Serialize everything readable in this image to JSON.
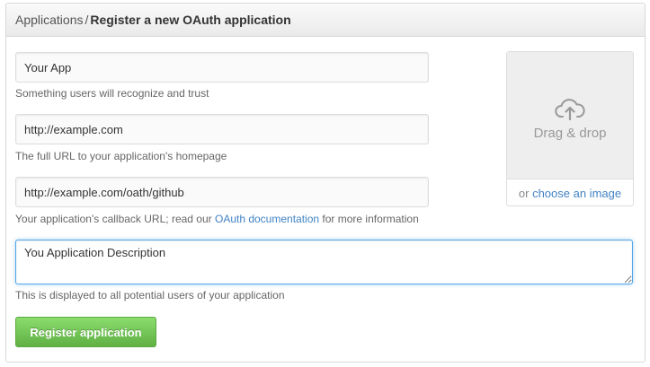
{
  "breadcrumb": {
    "parent": "Applications",
    "separator": "/",
    "current": "Register a new OAuth application"
  },
  "form": {
    "app_name": {
      "value": "Your App",
      "note": "Something users will recognize and trust"
    },
    "homepage_url": {
      "value": "http://example.com",
      "note": "The full URL to your application's homepage"
    },
    "callback_url": {
      "value": "http://example.com/oath/github",
      "note_prefix": "Your application's callback URL; read our ",
      "note_link": "OAuth documentation",
      "note_suffix": " for more information"
    },
    "description": {
      "value": "You Application Description",
      "note": "This is displayed to all potential users of your application"
    },
    "submit_label": "Register application"
  },
  "logo_upload": {
    "icon": "cloud-upload-icon",
    "drop_label": "Drag & drop",
    "or_text": "or ",
    "choose_link": "choose an image"
  },
  "colors": {
    "link": "#4183c4",
    "button_green": "#60b044",
    "focus_blue": "#51a7e8"
  }
}
